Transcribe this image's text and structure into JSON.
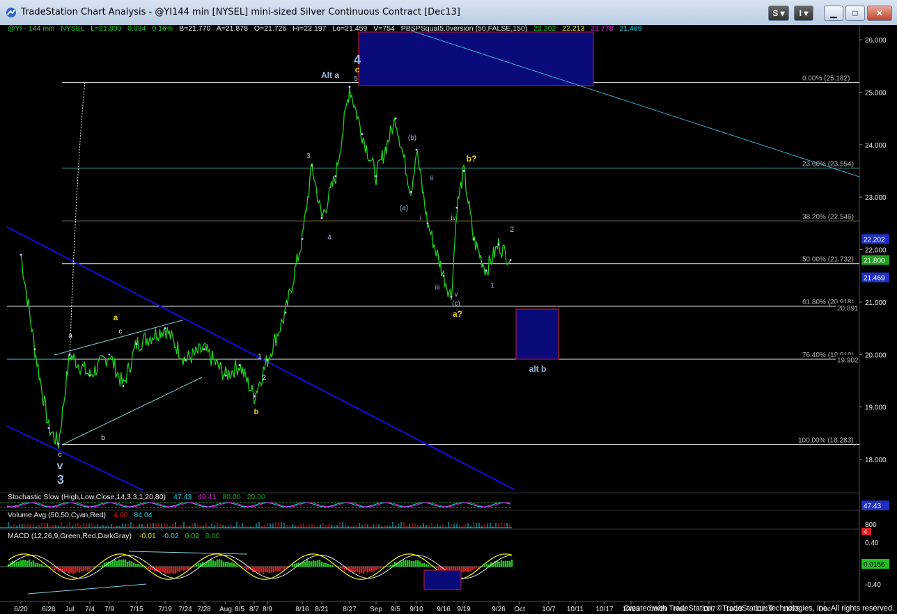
{
  "window": {
    "title": "TradeStation Chart Analysis - @YI144 min [NYSEL] mini-sized Silver Continuous Contract [Dec13]",
    "buttons": {
      "s": "S",
      "i": "I",
      "min": "",
      "max": "",
      "close": ""
    }
  },
  "header": {
    "symbol": "@YI - 144 min",
    "exchange": "NYSEL",
    "last": "L=21.800",
    "change": "0.034",
    "change_pct": "0.16%",
    "bid": "B=21.770",
    "ask": "A=21.878",
    "open": "O=21.726",
    "high": "Hi=22.197",
    "low": "Lo=21.459",
    "volume": "V=754",
    "study": "PBSPSquat5.0version (50,FALSE,150)",
    "study_values": [
      "22.202",
      "22.213",
      "21.778",
      "21.469"
    ]
  },
  "colors": {
    "price": "#20d020",
    "fib": "#e8e8e8",
    "fib_label": "#b0b0b0",
    "channel": "#1010e0",
    "trendline": "#40a8c8",
    "box_fill": "#0a0a7a",
    "box_border": "#d02020",
    "wave_yellow": "#e8d020",
    "wave_blue": "#a0b8e0"
  },
  "chart_data": [
    {
      "type": "line",
      "title": "",
      "ylim": [
        17.5,
        26.2
      ],
      "yticks": [
        "26.000",
        "25.000",
        "24.000",
        "23.000",
        "22.000",
        "21.000",
        "20.000",
        "19.000",
        "18.000"
      ],
      "xticks": [
        "6/20",
        "6/26",
        "Jul",
        "7/4",
        "7/9",
        "7/15",
        "7/19",
        "7/24",
        "7/28",
        "Aug",
        "8/5",
        "8/7",
        "8/9",
        "8/16",
        "8/21",
        "8/27",
        "Sep",
        "9/5",
        "9/10",
        "9/16",
        "9/19",
        "9/26",
        "Oct",
        "10/7",
        "10/11",
        "10/17",
        "10/23",
        "10/29",
        "Nov",
        "11/7",
        "11/13",
        "11/19",
        "11/25",
        "Dec"
      ],
      "series": [
        {
          "name": "@YI",
          "x": [
            "6/20",
            "6/24",
            "6/26",
            "6/28",
            "Jul",
            "7/4",
            "7/9",
            "7/12",
            "7/15",
            "7/19",
            "7/24",
            "7/28",
            "Aug",
            "8/5",
            "8/7",
            "8/9",
            "8/13",
            "8/16",
            "8/19",
            "8/21",
            "8/23",
            "8/27",
            "8/29",
            "Sep",
            "9/5",
            "9/9",
            "9/10",
            "9/12",
            "9/16",
            "9/17",
            "9/18",
            "9/19",
            "9/20",
            "9/23",
            "9/26",
            "9/27"
          ],
          "values": [
            21.9,
            20.1,
            18.6,
            18.3,
            20.0,
            19.6,
            20.0,
            19.4,
            20.2,
            20.5,
            19.9,
            20.1,
            19.6,
            19.8,
            19.2,
            19.9,
            20.8,
            22.2,
            23.6,
            22.6,
            23.4,
            25.1,
            24.2,
            23.4,
            24.5,
            23.1,
            23.9,
            22.5,
            21.5,
            21.1,
            22.8,
            23.5,
            22.2,
            21.6,
            22.1,
            21.8
          ]
        }
      ],
      "fib_levels": [
        {
          "label": "0.00% (25.182)",
          "value": 25.182
        },
        {
          "label": "23.60% (23.554)",
          "value": 23.554
        },
        {
          "label": "38.20% (22.546)",
          "value": 22.546
        },
        {
          "label": "50.00% (21.732)",
          "value": 21.732
        },
        {
          "label": "61.80% (20.918)",
          "value": 20.918
        },
        {
          "label": "76.40% (19.910)",
          "value": 19.91
        },
        {
          "label": "100.00% (18.283)",
          "value": 18.283
        }
      ],
      "price_labels": [
        {
          "text": "22.202",
          "value": 22.202,
          "color": "#2030c0"
        },
        {
          "text": "21.800",
          "value": 21.8,
          "color": "#20a020"
        },
        {
          "text": "21.469",
          "value": 21.469,
          "color": "#2030c0"
        },
        {
          "text": "20.891",
          "value": 20.891,
          "color": "#000000"
        },
        {
          "text": "19.902",
          "value": 19.902,
          "color": "#000000"
        }
      ],
      "annotations": [
        {
          "text": "4",
          "color": "#a0b8e0"
        },
        {
          "text": "c",
          "color": "#e8d020"
        },
        {
          "text": "5",
          "color": "#a0b8e0"
        },
        {
          "text": "Alt a",
          "color": "#a0b8e0"
        },
        {
          "text": "3",
          "color": "#a0b8e0"
        },
        {
          "text": "4",
          "color": "#a0b8e0"
        },
        {
          "text": "(b)",
          "color": "#a0b8e0"
        },
        {
          "text": "(a)",
          "color": "#a0b8e0"
        },
        {
          "text": "ii",
          "color": "#a0b8e0"
        },
        {
          "text": "i",
          "color": "#a0b8e0"
        },
        {
          "text": "iii",
          "color": "#a0b8e0"
        },
        {
          "text": "iv",
          "color": "#a0b8e0"
        },
        {
          "text": "v",
          "color": "#a0b8e0"
        },
        {
          "text": "(c)",
          "color": "#a0b8e0"
        },
        {
          "text": "b?",
          "color": "#e8d020"
        },
        {
          "text": "a?",
          "color": "#e8d020"
        },
        {
          "text": "2",
          "color": "#a0b8e0"
        },
        {
          "text": "1",
          "color": "#a0b8e0"
        },
        {
          "text": "alt b",
          "color": "#a0b8e0"
        },
        {
          "text": "a",
          "color": "#e8d020"
        },
        {
          "text": "c",
          "color": "#e8e8e8"
        },
        {
          "text": "a",
          "color": "#e8e8e8"
        },
        {
          "text": "b",
          "color": "#e8e8e8"
        },
        {
          "text": "b",
          "color": "#e8d020"
        },
        {
          "text": "1",
          "color": "#e8e8e8"
        },
        {
          "text": "2",
          "color": "#e8e8e8"
        },
        {
          "text": "c",
          "color": "#e8e8e8"
        },
        {
          "text": "v",
          "color": "#a0b8e0"
        },
        {
          "text": "3",
          "color": "#a0b8e0"
        }
      ]
    },
    {
      "type": "line",
      "title": "Stochastic Slow (High,Low,Close,14,3,3,1,20,80)",
      "values_text": [
        "47.43",
        "49.41",
        "80.00",
        "20.00"
      ],
      "last_value": "47.43",
      "ylim": [
        0,
        100
      ]
    },
    {
      "type": "bar",
      "title": "Volume Avg (50,50,Cyan,Red)",
      "values_text": [
        "4.00",
        "84.04"
      ],
      "yticks": [
        "800",
        "4"
      ]
    },
    {
      "type": "line",
      "title": "MACD (12,26,9,Green,Red,DarkGray)",
      "values_text": [
        "-0.01",
        "-0.02",
        "0.02",
        "0.00"
      ],
      "yticks": [
        "0.40",
        "0.0156",
        "-0.40"
      ],
      "ylim": [
        -0.55,
        0.55
      ]
    }
  ],
  "footer": "Created with TradeStation. ©TradeStation Technologies, Inc. All rights reserved."
}
